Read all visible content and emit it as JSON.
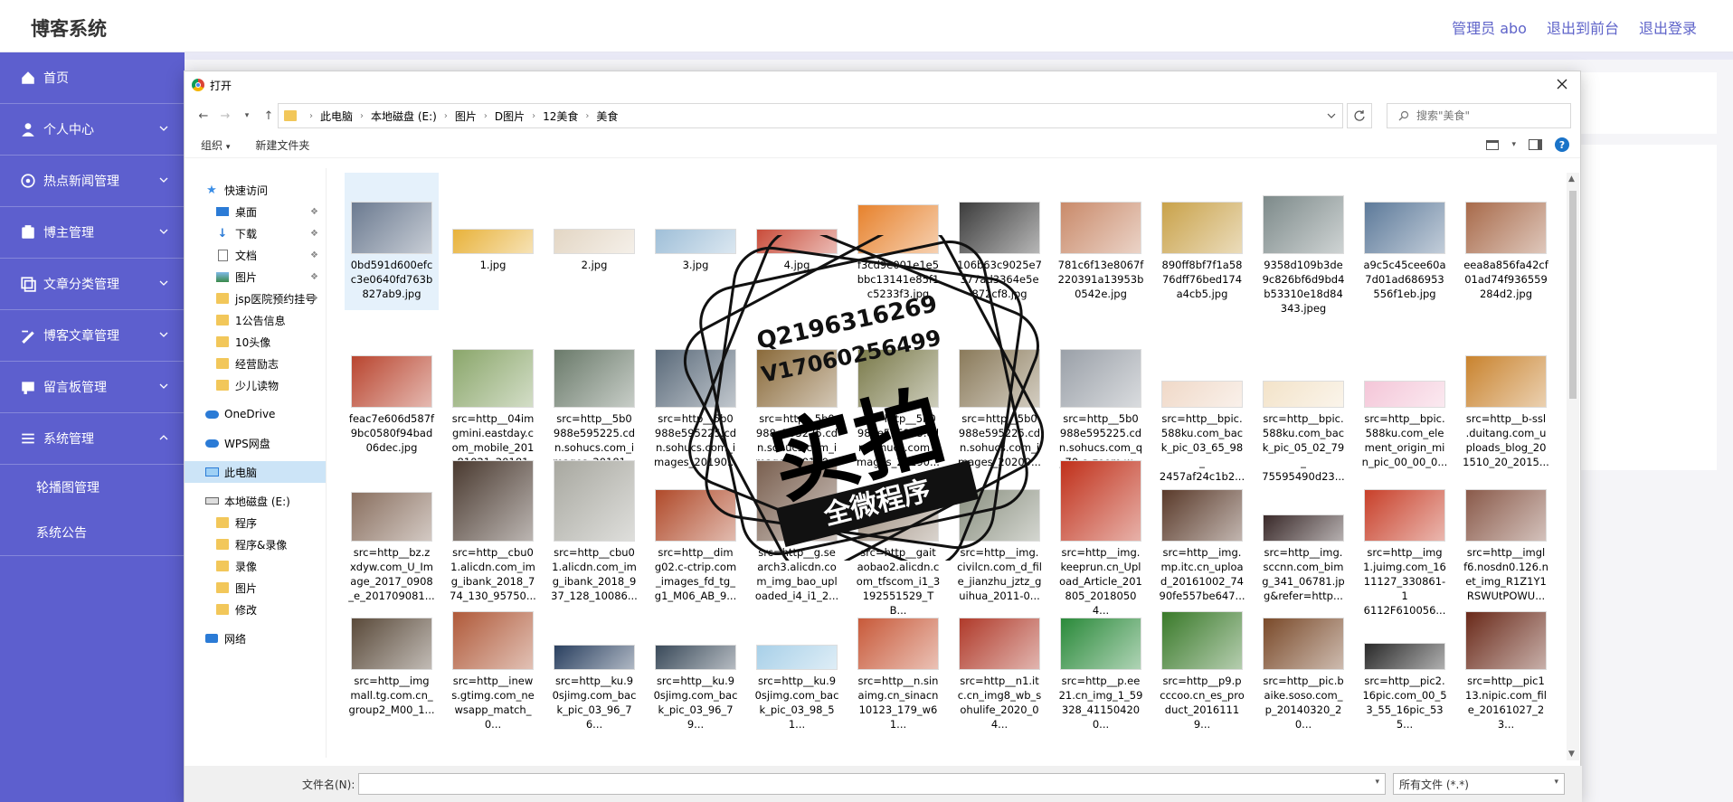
{
  "app": {
    "title": "博客系统",
    "admin": "管理员 abo",
    "to_front": "退出到前台",
    "logout": "退出登录"
  },
  "sidebar": {
    "items": [
      {
        "label": "首页",
        "icon": "home-icon",
        "expandable": false
      },
      {
        "label": "个人中心",
        "icon": "user-icon",
        "expandable": true
      },
      {
        "label": "热点新闻管理",
        "icon": "news-icon",
        "expandable": true
      },
      {
        "label": "博主管理",
        "icon": "blogger-icon",
        "expandable": true
      },
      {
        "label": "文章分类管理",
        "icon": "category-icon",
        "expandable": true
      },
      {
        "label": "博客文章管理",
        "icon": "article-icon",
        "expandable": true
      },
      {
        "label": "留言板管理",
        "icon": "message-icon",
        "expandable": true
      },
      {
        "label": "系统管理",
        "icon": "system-icon",
        "expandable": true,
        "expanded": true
      }
    ],
    "subitems": [
      {
        "label": "轮播图管理"
      },
      {
        "label": "系统公告"
      }
    ]
  },
  "dialog": {
    "title": "打开",
    "breadcrumbs": [
      "此电脑",
      "本地磁盘 (E:)",
      "图片",
      "D图片",
      "12美食",
      "美食"
    ],
    "search_placeholder": "搜索\"美食\"",
    "toolbar": {
      "organize": "组织",
      "new_folder": "新建文件夹"
    },
    "filename_label": "文件名(N):",
    "filename_value": "",
    "filetype": "所有文件 (*.*)"
  },
  "navpane": [
    {
      "label": "快速访问",
      "icon": "star-icon",
      "indent": 0
    },
    {
      "label": "桌面",
      "icon": "desktop-icon",
      "indent": 1,
      "pinned": true
    },
    {
      "label": "下载",
      "icon": "download-icon",
      "indent": 1,
      "pinned": true
    },
    {
      "label": "文档",
      "icon": "document-icon",
      "indent": 1,
      "pinned": true
    },
    {
      "label": "图片",
      "icon": "picture-icon",
      "indent": 1,
      "pinned": true
    },
    {
      "label": "jsp医院预约挂号",
      "icon": "folder-icon",
      "indent": 1,
      "pinned": true
    },
    {
      "label": "1公告信息",
      "icon": "folder-icon",
      "indent": 1
    },
    {
      "label": "10头像",
      "icon": "folder-icon",
      "indent": 1
    },
    {
      "label": "经营励志",
      "icon": "folder-icon",
      "indent": 1
    },
    {
      "label": "少儿读物",
      "icon": "folder-icon",
      "indent": 1
    },
    {
      "label": "",
      "icon": "",
      "indent": 0,
      "spacer": true
    },
    {
      "label": "OneDrive",
      "icon": "cloud-icon",
      "indent": 0
    },
    {
      "label": "",
      "icon": "",
      "indent": 0,
      "spacer": true
    },
    {
      "label": "WPS网盘",
      "icon": "cloud-icon",
      "indent": 0
    },
    {
      "label": "",
      "icon": "",
      "indent": 0,
      "spacer": true
    },
    {
      "label": "此电脑",
      "icon": "computer-icon",
      "indent": 0,
      "selected": true
    },
    {
      "label": "",
      "icon": "",
      "indent": 0,
      "spacer": true
    },
    {
      "label": "本地磁盘 (E:)",
      "icon": "disk-icon",
      "indent": 0
    },
    {
      "label": "程序",
      "icon": "folder-icon",
      "indent": 1
    },
    {
      "label": "程序&录像",
      "icon": "folder-icon",
      "indent": 1
    },
    {
      "label": "录像",
      "icon": "folder-icon",
      "indent": 1
    },
    {
      "label": "图片",
      "icon": "folder-icon",
      "indent": 1
    },
    {
      "label": "修改",
      "icon": "folder-icon",
      "indent": 1
    },
    {
      "label": "",
      "icon": "",
      "indent": 0,
      "spacer": true
    },
    {
      "label": "网络",
      "icon": "network-icon",
      "indent": 0
    }
  ],
  "files": [
    {
      "name": "0bd591d600efc\nc3e0640fd763b\n827ab9.jpg",
      "color": "#6b7a90",
      "th": 58,
      "selected": true
    },
    {
      "name": "1.jpg",
      "color": "#e8b23a",
      "th": 28
    },
    {
      "name": "2.jpg",
      "color": "#e3d6c4",
      "th": 28
    },
    {
      "name": "3.jpg",
      "color": "#9fbfd8",
      "th": 28
    },
    {
      "name": "4.jpg",
      "color": "#c94c3a",
      "th": 28
    },
    {
      "name": "f3cd9e001e1e5\nbbc13141e85f1\nc5233f3.jpg",
      "color": "#e7822d",
      "th": 55
    },
    {
      "name": "106b63c9025e7\n377ad3364e5e\n872cf8.jpg",
      "color": "#3c3c3c",
      "th": 58
    },
    {
      "name": "781c6f13e8067f\n220391a13953b\n0542e.jpg",
      "color": "#c98a6a",
      "th": 58
    },
    {
      "name": "890ff8bf7f1a58\n76dff76bed174\na4cb5.jpg",
      "color": "#c9a24a",
      "th": 58
    },
    {
      "name": "9358d109b3de\n9c826bf6d9bd4\nb53310e18d84\n343.jpeg",
      "color": "#7d8a8a",
      "th": 65
    },
    {
      "name": "a9c5c45cee60a\n7d01ad686953\n556f1eb.jpg",
      "color": "#5d7a9a",
      "th": 58
    },
    {
      "name": "eea8a856fa42cf\n01ad74f936559\n284d2.jpg",
      "color": "#a86a4a",
      "th": 58
    },
    {
      "name": "feac7e606d587f\n9bc0580f94bad\n06dec.jpg",
      "color": "#b9452f",
      "th": 58
    },
    {
      "name": "src=http__04im\ngmini.eastday.c\nom_mobile_201\n81021_201810...",
      "color": "#8aa66a",
      "th": 65
    },
    {
      "name": "src=http__5b0\n988e595225.cd\nn.sohucs.com_i\nmages_20181...",
      "color": "#6a7a6a",
      "th": 65
    },
    {
      "name": "src=http__5b0\n988e595225.cd\nn.sohucs.com_i\nmages_20190...",
      "color": "#5a6a7a",
      "th": 65
    },
    {
      "name": "src=http__5b0\n988e595225.cd\nn.sohucs.com_i\nmages_20190...",
      "color": "#8a6a3a",
      "th": 65
    },
    {
      "name": "src=http__5b0\n988e595225.cd\nn.sohucs.com_i\nmages_20190...",
      "color": "#7a7a4a",
      "th": 65
    },
    {
      "name": "src=http__5b0\n988e595225.cd\nn.sohucs.com_i\nmages_20200...",
      "color": "#8a7a5a",
      "th": 65
    },
    {
      "name": "src=http__5b0\n988e595225.cd\nn.sohucs.com_q\n_70,c_zoom,w...",
      "color": "#9aa0a8",
      "th": 65
    },
    {
      "name": "src=http__bpic.\n588ku.com_bac\nk_pic_03_65_98_\n2457af24c1b2...",
      "color": "#f0d9c8",
      "th": 30
    },
    {
      "name": "src=http__bpic.\n588ku.com_bac\nk_pic_05_02_79_\n75595490d23...",
      "color": "#f3e3c9",
      "th": 30
    },
    {
      "name": "src=http__bpic.\n588ku.com_ele\nment_origin_mi\nn_pic_00_00_0...",
      "color": "#f4c6d8",
      "th": 30
    },
    {
      "name": "src=http__b-ssl\n.duitang.com_u\nploads_blog_20\n1510_20_2015...",
      "color": "#c9832e",
      "th": 58
    },
    {
      "name": "src=http__bz.z\nxdyw.com_U_Im\nage_2017_0908\n_e_201709081...",
      "color": "#8a7060",
      "th": 55
    },
    {
      "name": "src=http__cbu0\n1.alicdn.com_im\ng_ibank_2018_7\n74_130_95750...",
      "color": "#4a3a30",
      "th": 90
    },
    {
      "name": "src=http__cbu0\n1.alicdn.com_im\ng_ibank_2018_9\n37_128_10086...",
      "color": "#a8a8a0",
      "th": 90
    },
    {
      "name": "src=http__dim\ng02.c-ctrip.com\n_images_fd_tg_\ng1_M06_AB_9...",
      "color": "#b04a2a",
      "th": 58
    },
    {
      "name": "src=http__g.se\narch3.alicdn.co\nm_img_bao_upl\noaded_i4_i1_2...",
      "color": "#7a6050",
      "th": 90
    },
    {
      "name": "src=http__gait\naobao2.alicdn.c\nom_tfscom_i1_3\n192551529_TB...",
      "color": "#9a8a7a",
      "th": 58
    },
    {
      "name": "src=http__img.\ncivilcn.com_d_fil\ne_jianzhu_jztz_g\nuihua_2011-0...",
      "color": "#8a9080",
      "th": 58
    },
    {
      "name": "src=http__img.\nkeeprun.cn_Upl\noad_Article_201\n805_20180504...",
      "color": "#c0301a",
      "th": 90
    },
    {
      "name": "src=http__img.\nmp.itc.cn_uploa\nd_20161002_74\n90fe557be647...",
      "color": "#5a3a2a",
      "th": 58
    },
    {
      "name": "src=http__img.\nsccnn.com_bim\ng_341_06781.jp\ng&refer=http...",
      "color": "#3a2a2a",
      "th": 30
    },
    {
      "name": "src=http__img\n1.juimg.com_16\n11127_330861-1\n6112F610056...",
      "color": "#c8402a",
      "th": 58
    },
    {
      "name": "src=http__imgl\nf6.nosdn0.126.n\net_img_R1Z1Y1\nRSWUtPOWU...",
      "color": "#8a5a4a",
      "th": 58
    },
    {
      "name": "src=http__img\nmall.tg.com.cn_\ngroup2_M00_1...",
      "color": "#5a4a3a",
      "th": 58
    },
    {
      "name": "src=http__inew\ns.gtimg.com_ne\nwsapp_match_0...",
      "color": "#b05a3a",
      "th": 65
    },
    {
      "name": "src=http__ku.9\n0sjimg.com_bac\nk_pic_03_96_76...",
      "color": "#2a4060",
      "th": 28
    },
    {
      "name": "src=http__ku.9\n0sjimg.com_bac\nk_pic_03_96_79...",
      "color": "#3a4a5a",
      "th": 28
    },
    {
      "name": "src=http__ku.9\n0sjimg.com_bac\nk_pic_03_98_51...",
      "color": "#a8d0e8",
      "th": 28
    },
    {
      "name": "src=http__n.sin\naimg.cn_sinacn\n10123_179_w61...",
      "color": "#c85a3a",
      "th": 58
    },
    {
      "name": "src=http__n1.it\nc.cn_img8_wb_s\nohulife_2020_04...",
      "color": "#b03a2a",
      "th": 58
    },
    {
      "name": "src=http__p.ee\n21.cn_img_1_59\n328_411504200...",
      "color": "#2a8a3a",
      "th": 58
    },
    {
      "name": "src=http__p9.p\ncccoo.cn_es_pro\nduct_20161119...",
      "color": "#3a7a2a",
      "th": 65
    },
    {
      "name": "src=http__pic.b\naike.soso.com_\np_20140320_20...",
      "color": "#7a4a2a",
      "th": 58
    },
    {
      "name": "src=http__pic2.\n16pic.com_00_5\n3_55_16pic_535...",
      "color": "#2a2a2a",
      "th": 30
    },
    {
      "name": "src=http__pic1\n13.nipic.com_fil\ne_20161027_23...",
      "color": "#6a2a1a",
      "th": 65
    }
  ],
  "watermark": {
    "line1": "Q2196316269",
    "line2": "V17060256499",
    "big": "实拍",
    "ribbon": "全微程序"
  }
}
